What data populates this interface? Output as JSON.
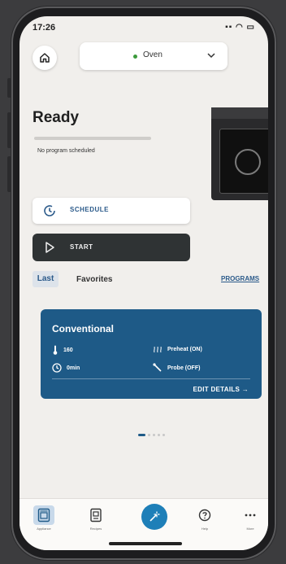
{
  "status_bar": {
    "time": "17:26",
    "icons": "▪▪ ◠ ▭"
  },
  "header": {
    "appliance": "Oven"
  },
  "status": {
    "title": "Ready",
    "schedule_text": "No program scheduled"
  },
  "actions": {
    "schedule": "SCHEDULE",
    "start": "START"
  },
  "tabs": {
    "last": "Last",
    "favorites": "Favorites",
    "programs": "PROGRAMS"
  },
  "program_card": {
    "title": "Conventional",
    "temperature": "160",
    "preheat": "Preheat (ON)",
    "duration": "0min",
    "probe": "Probe (OFF)",
    "edit": "EDIT DETAILS →"
  },
  "pager": {
    "count": 5,
    "active": 0
  },
  "bottom_nav": [
    {
      "label": "Appliance",
      "icon": "appliance-icon"
    },
    {
      "label": "Recipes",
      "icon": "recipes-icon"
    },
    {
      "label": "",
      "icon": "magic-wand-icon"
    },
    {
      "label": "Help",
      "icon": "help-icon"
    },
    {
      "label": "More",
      "icon": "more-icon"
    }
  ],
  "colors": {
    "accent": "#1e5a87",
    "nav_center": "#1e7fb8",
    "background": "#f1efec",
    "start_button": "#2f3334"
  }
}
